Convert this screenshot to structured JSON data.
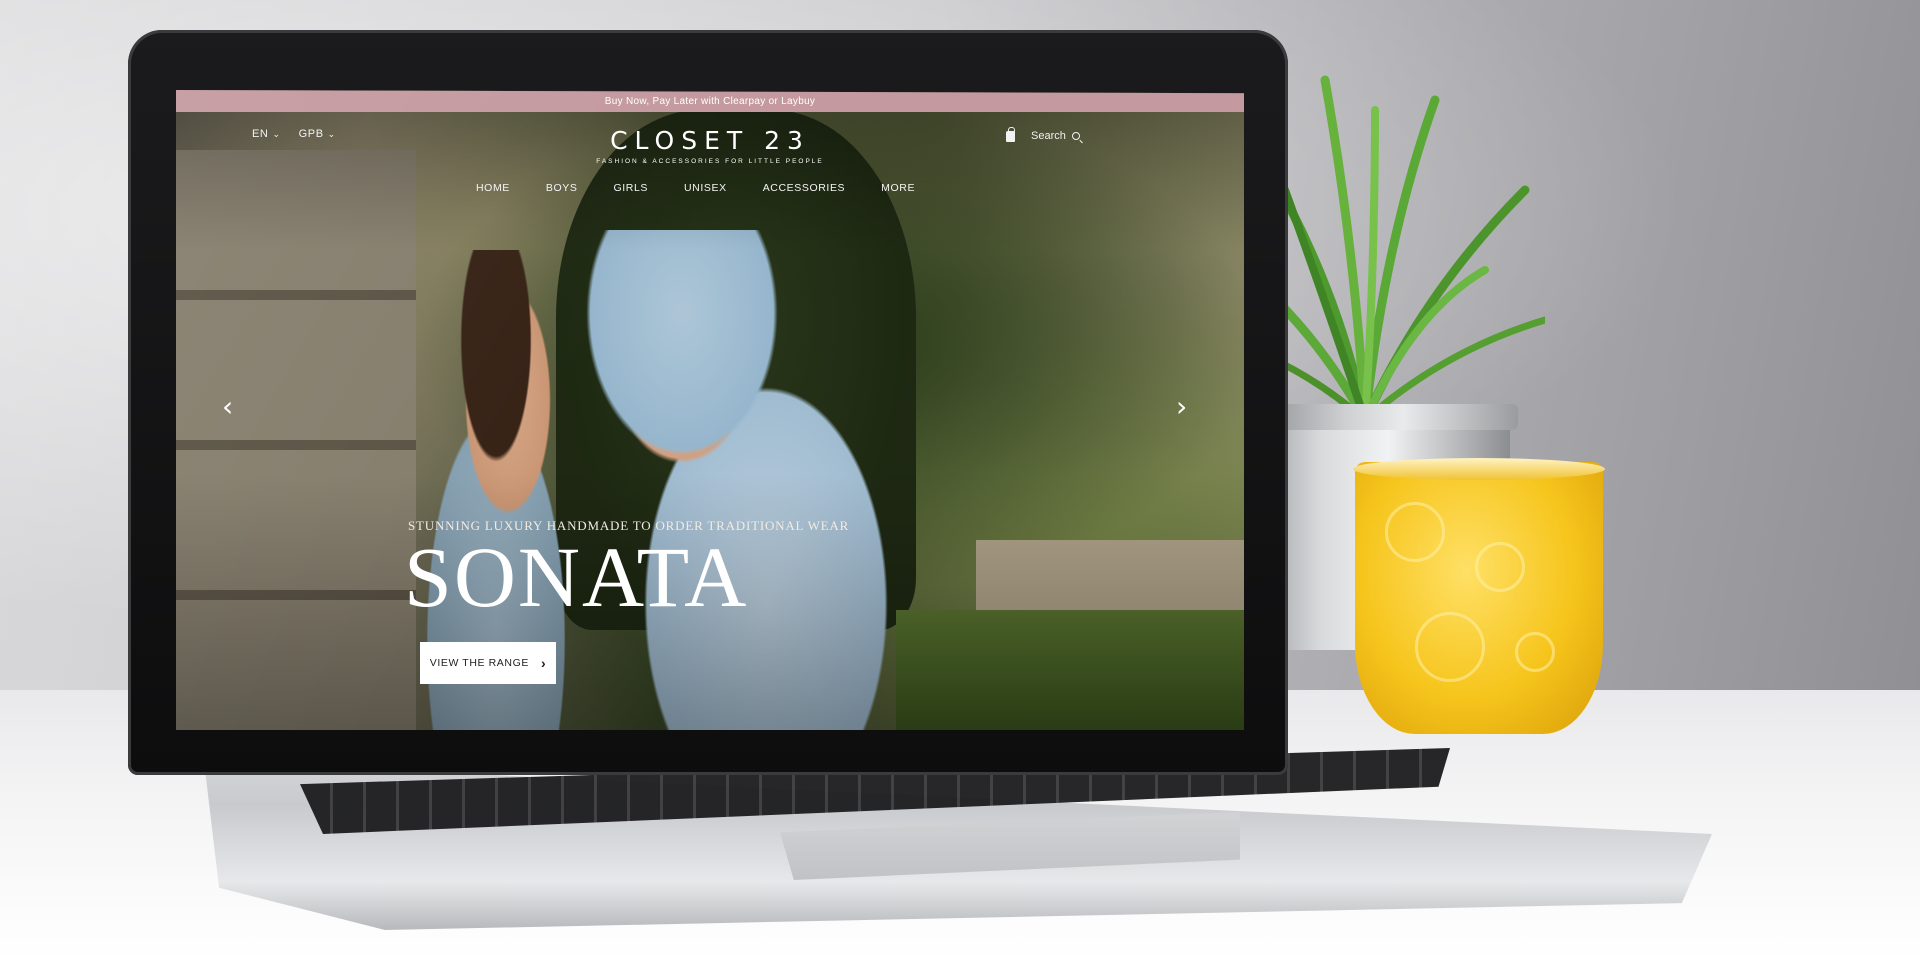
{
  "promo": {
    "text": "Buy Now, Pay Later with Clearpay or Laybuy"
  },
  "header": {
    "language": "EN",
    "currency": "GPB",
    "search_label": "Search"
  },
  "logo": {
    "name": "CLOSET 23",
    "tagline": "FASHION & ACCESSORIES FOR LITTLE PEOPLE"
  },
  "nav": {
    "items": [
      {
        "label": "HOME"
      },
      {
        "label": "BOYS"
      },
      {
        "label": "GIRLS"
      },
      {
        "label": "UNISEX"
      },
      {
        "label": "ACCESSORIES"
      },
      {
        "label": "MORE"
      }
    ]
  },
  "hero": {
    "subtitle": "STUNNING LUXURY HANDMADE TO ORDER TRADITIONAL WEAR",
    "title": "SONATA",
    "cta_label": "VIEW THE RANGE"
  },
  "colors": {
    "promo_bar": "#c49aa0",
    "cup": "#f6c51c",
    "plant": "#5fa83a"
  },
  "icons": {
    "bag": "shopping-bag-icon",
    "search": "search-icon",
    "prev": "chevron-left-icon",
    "next": "chevron-right-icon"
  }
}
